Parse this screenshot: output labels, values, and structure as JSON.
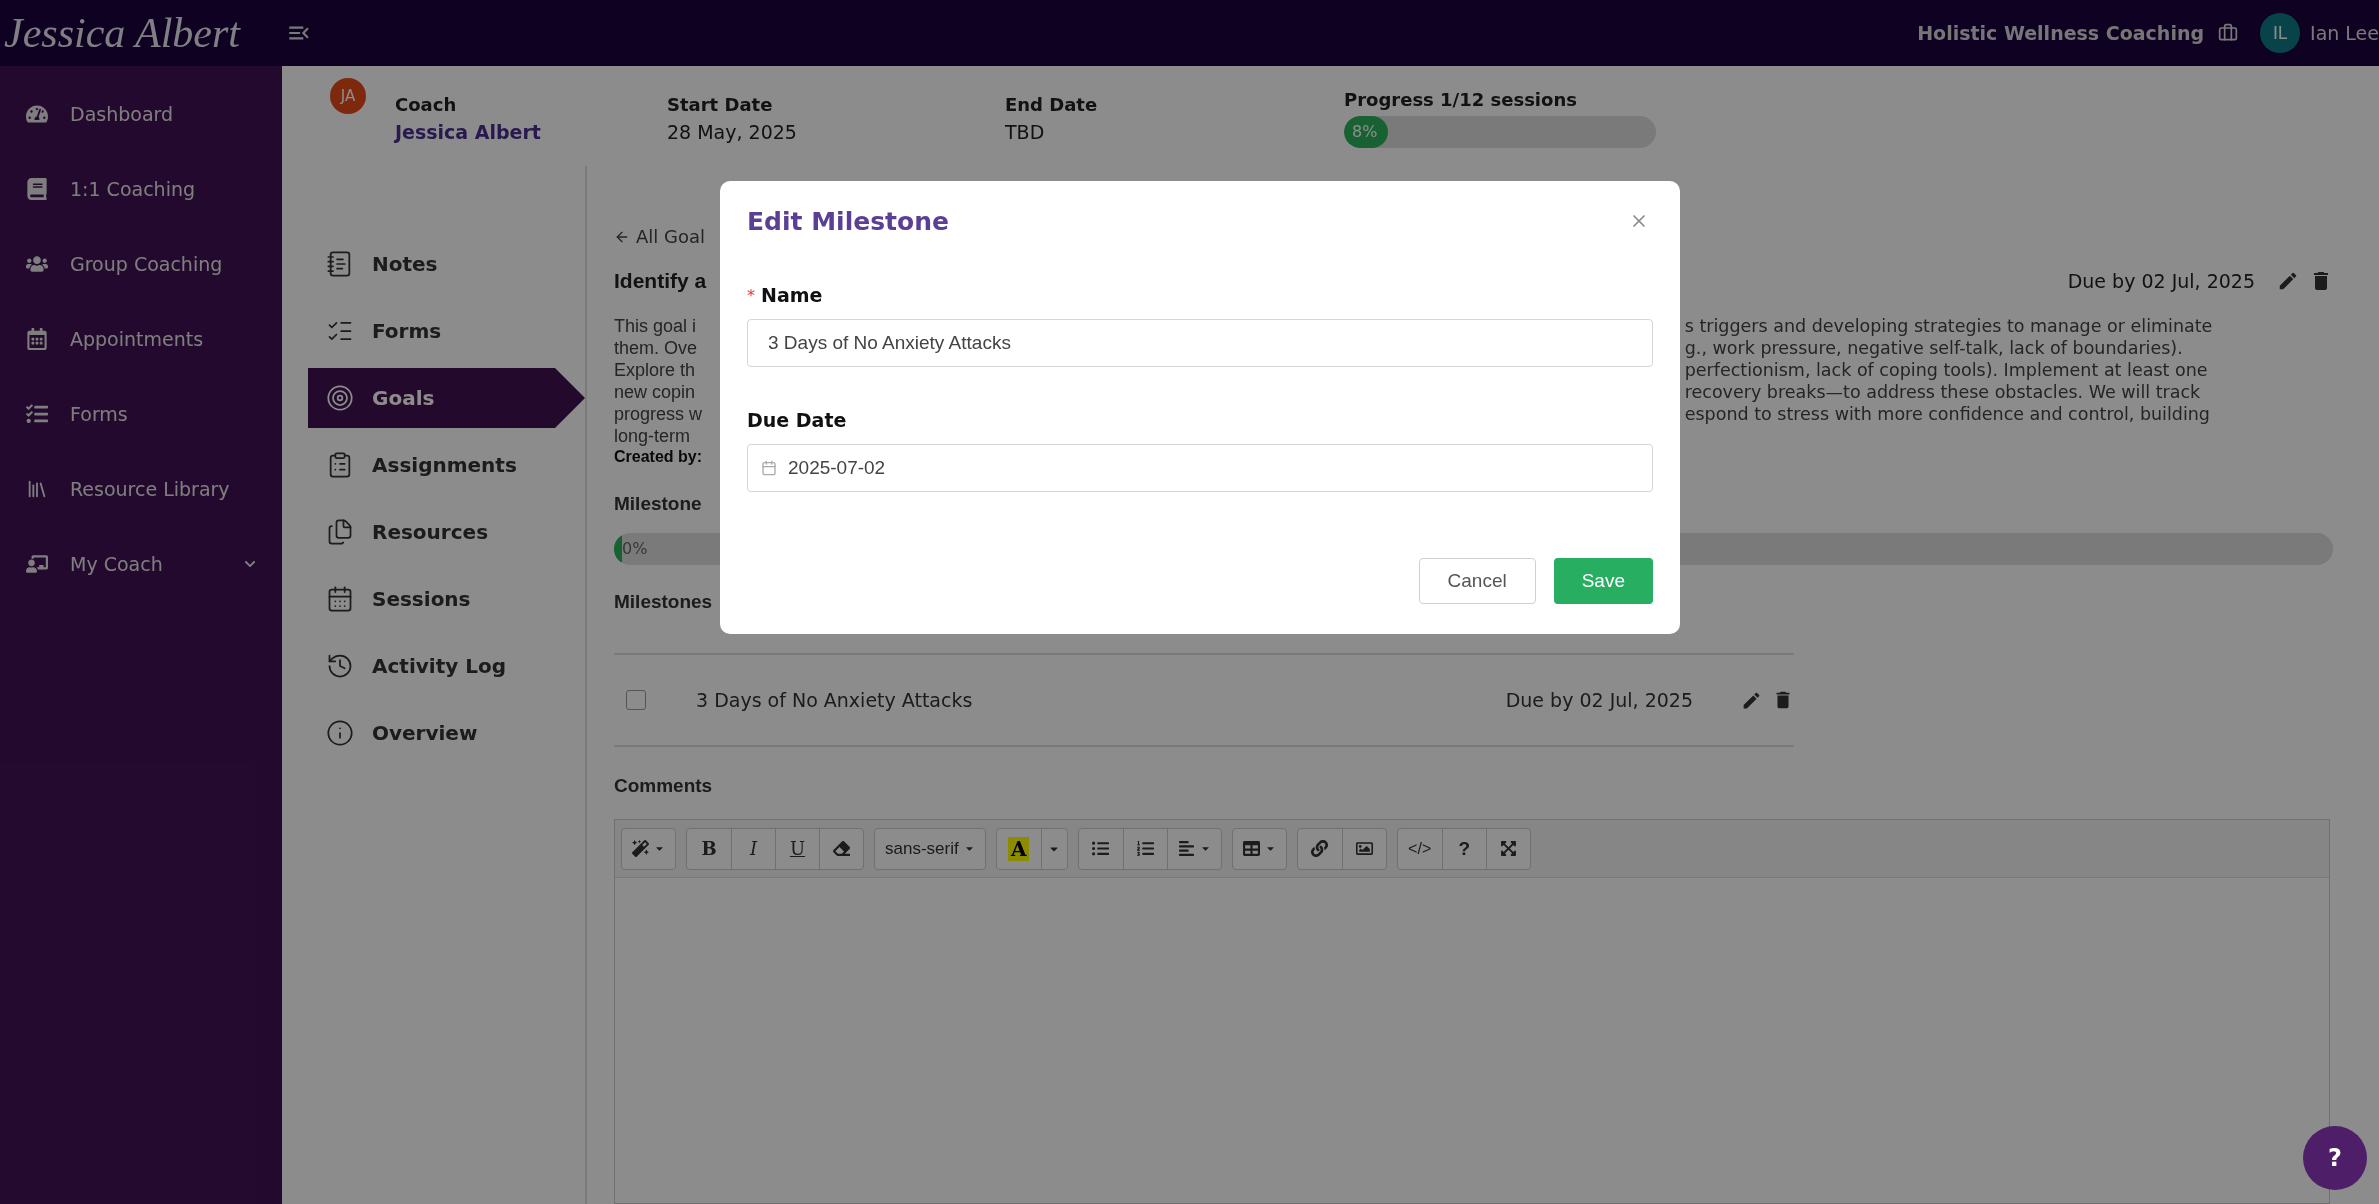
{
  "header": {
    "logo": "Jessica Albert",
    "workspace": "Holistic Wellness Coaching",
    "user": {
      "initials": "IL",
      "name": "Ian Lee"
    }
  },
  "sidebar": {
    "items": [
      {
        "label": "Dashboard",
        "selected": false,
        "expandable": false
      },
      {
        "label": "1:1 Coaching",
        "selected": false,
        "expandable": false
      },
      {
        "label": "Group Coaching",
        "selected": false,
        "expandable": false
      },
      {
        "label": "Appointments",
        "selected": false,
        "expandable": false
      },
      {
        "label": "Forms",
        "selected": false,
        "expandable": false
      },
      {
        "label": "Resource Library",
        "selected": false,
        "expandable": false
      },
      {
        "label": "My Coach",
        "selected": false,
        "expandable": true
      }
    ]
  },
  "engagement": {
    "coach": {
      "label": "Coach",
      "initials": "JA",
      "name": "Jessica Albert"
    },
    "start": {
      "label": "Start Date",
      "value": "28 May, 2025"
    },
    "end": {
      "label": "End Date",
      "value": "TBD"
    },
    "progress": {
      "label": "Progress 1/12 sessions",
      "level": 0.08,
      "reading": "8%"
    }
  },
  "tabs": [
    {
      "label": "Notes",
      "selected": false
    },
    {
      "label": "Forms",
      "selected": false
    },
    {
      "label": "Goals",
      "selected": true
    },
    {
      "label": "Assignments",
      "selected": false
    },
    {
      "label": "Resources",
      "selected": false
    },
    {
      "label": "Sessions",
      "selected": false
    },
    {
      "label": "Activity Log",
      "selected": false
    },
    {
      "label": "Overview",
      "selected": false
    }
  ],
  "goal": {
    "back": "All Goal",
    "title": "Identify a",
    "due": "Due by 02 Jul, 2025",
    "description_left": [
      "This goal i",
      "them. Ove",
      "Explore th",
      "new copin",
      "progress w",
      "long-term"
    ],
    "description_right": [
      "s triggers and developing strategies to manage or eliminate",
      "g., work pressure, negative self-talk, lack of boundaries).",
      "perfectionism, lack of coping tools). Implement at least one",
      "recovery breaks—to address these obstacles. We will track",
      "espond to stress with more confidence and control, building"
    ],
    "created_by": "Created by:",
    "progress_label": "Milestone",
    "progress": {
      "level": 0,
      "reading": "0%"
    },
    "milestones_label": "Milestones",
    "milestones": [
      {
        "name": "3 Days of No Anxiety Attacks",
        "due": "Due by 02 Jul, 2025",
        "checked": false
      }
    ]
  },
  "comments": {
    "label": "Comments",
    "toolbar": [
      [
        {
          "kind": "wand"
        }
      ],
      [
        {
          "kind": "bold",
          "label": "B"
        },
        {
          "kind": "italic",
          "label": "I"
        },
        {
          "kind": "underline",
          "label": "U"
        },
        {
          "kind": "eraser"
        }
      ],
      [
        {
          "kind": "font",
          "label": "sans-serif"
        }
      ],
      [
        {
          "kind": "color",
          "label": "A"
        },
        {
          "kind": "caret"
        }
      ],
      [
        {
          "kind": "bullets"
        },
        {
          "kind": "numbers"
        },
        {
          "kind": "align"
        }
      ],
      [
        {
          "kind": "table"
        }
      ],
      [
        {
          "kind": "link"
        },
        {
          "kind": "image"
        }
      ],
      [
        {
          "kind": "code",
          "label": "</>"
        },
        {
          "kind": "help",
          "label": "?"
        },
        {
          "kind": "fullscreen"
        }
      ]
    ]
  },
  "modal": {
    "title": "Edit Milestone",
    "fields": [
      {
        "label": "Name",
        "required_mark": "*",
        "kind": "text",
        "value": "3 Days of No Anxiety Attacks"
      },
      {
        "label": "Due Date",
        "kind": "date",
        "value": "2025-07-02"
      }
    ],
    "buttons": [
      {
        "label": "Cancel",
        "kind": "secondary"
      },
      {
        "label": "Save",
        "kind": "primary"
      }
    ]
  },
  "help": {
    "label": "?"
  }
}
